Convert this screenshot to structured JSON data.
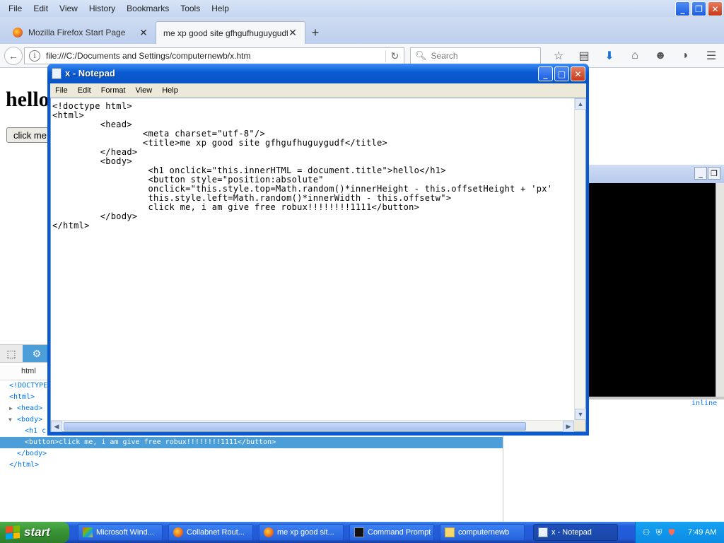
{
  "firefox": {
    "menu": [
      "File",
      "Edit",
      "View",
      "History",
      "Bookmarks",
      "Tools",
      "Help"
    ],
    "tabs": [
      {
        "title": "Mozilla Firefox Start Page",
        "active": false
      },
      {
        "title": "me xp good site gfhgufhuguygudf",
        "active": true
      }
    ],
    "url": "file:///C:/Documents and Settings/computernewb/x.htm",
    "search_placeholder": "Search",
    "icons": [
      "star-icon",
      "reading-list-icon",
      "download-icon",
      "home-icon",
      "smiley-icon",
      "pocket-icon",
      "menu-icon"
    ]
  },
  "page": {
    "heading": "hello",
    "button": "click me"
  },
  "devtools": {
    "breadcrumb": "html",
    "tree": [
      {
        "text": "<!DOCTYPE html>",
        "indent": 0
      },
      {
        "text": "<html>",
        "indent": 0
      },
      {
        "text": "<head>",
        "indent": 1
      },
      {
        "text": "<body>",
        "indent": 1
      },
      {
        "text": "<h1 c",
        "indent": 2
      },
      {
        "text": "<button>click me, i am give free robux!!!!!!!!1111</button>",
        "indent": 2,
        "selected": true
      },
      {
        "text": "</body>",
        "indent": 1
      },
      {
        "text": "</html>",
        "indent": 0
      }
    ],
    "inline_label": "inline"
  },
  "notepad": {
    "title": "x - Notepad",
    "menu": [
      "File",
      "Edit",
      "Format",
      "View",
      "Help"
    ],
    "content": "<!doctype html>\n<html>\n         <head>\n                 <meta charset=\"utf-8\"/>\n                 <title>me xp good site gfhgufhuguygudf</title>\n         </head>\n         <body>\n                  <h1 onclick=\"this.innerHTML = document.title\">hello</h1>\n                  <button style=\"position:absolute\"\n                  onclick=\"this.style.top=Math.random()*innerHeight - this.offsetHeight + 'px'\n                  this.style.left=Math.random()*innerWidth - this.offsetw\">\n                  click me, i am give free robux!!!!!!!!1111</button>\n         </body>\n</html>"
  },
  "taskbar": {
    "start": "start",
    "tasks": [
      {
        "label": "Microsoft Wind...",
        "icon": "windows-update-icon",
        "active": false
      },
      {
        "label": "Collabnet Rout...",
        "icon": "firefox-icon",
        "active": false
      },
      {
        "label": "me xp good sit...",
        "icon": "firefox-icon",
        "active": false
      },
      {
        "label": "Command Prompt",
        "icon": "cmd-icon",
        "active": false
      },
      {
        "label": "computernewb",
        "icon": "folder-icon",
        "active": false
      },
      {
        "label": "x - Notepad",
        "icon": "notepad-icon",
        "active": true
      }
    ],
    "clock": "7:49 AM"
  },
  "colors": {
    "xp_blue": "#245edc",
    "start_green": "#3a9636",
    "devtools_select": "#4c9ed9"
  }
}
